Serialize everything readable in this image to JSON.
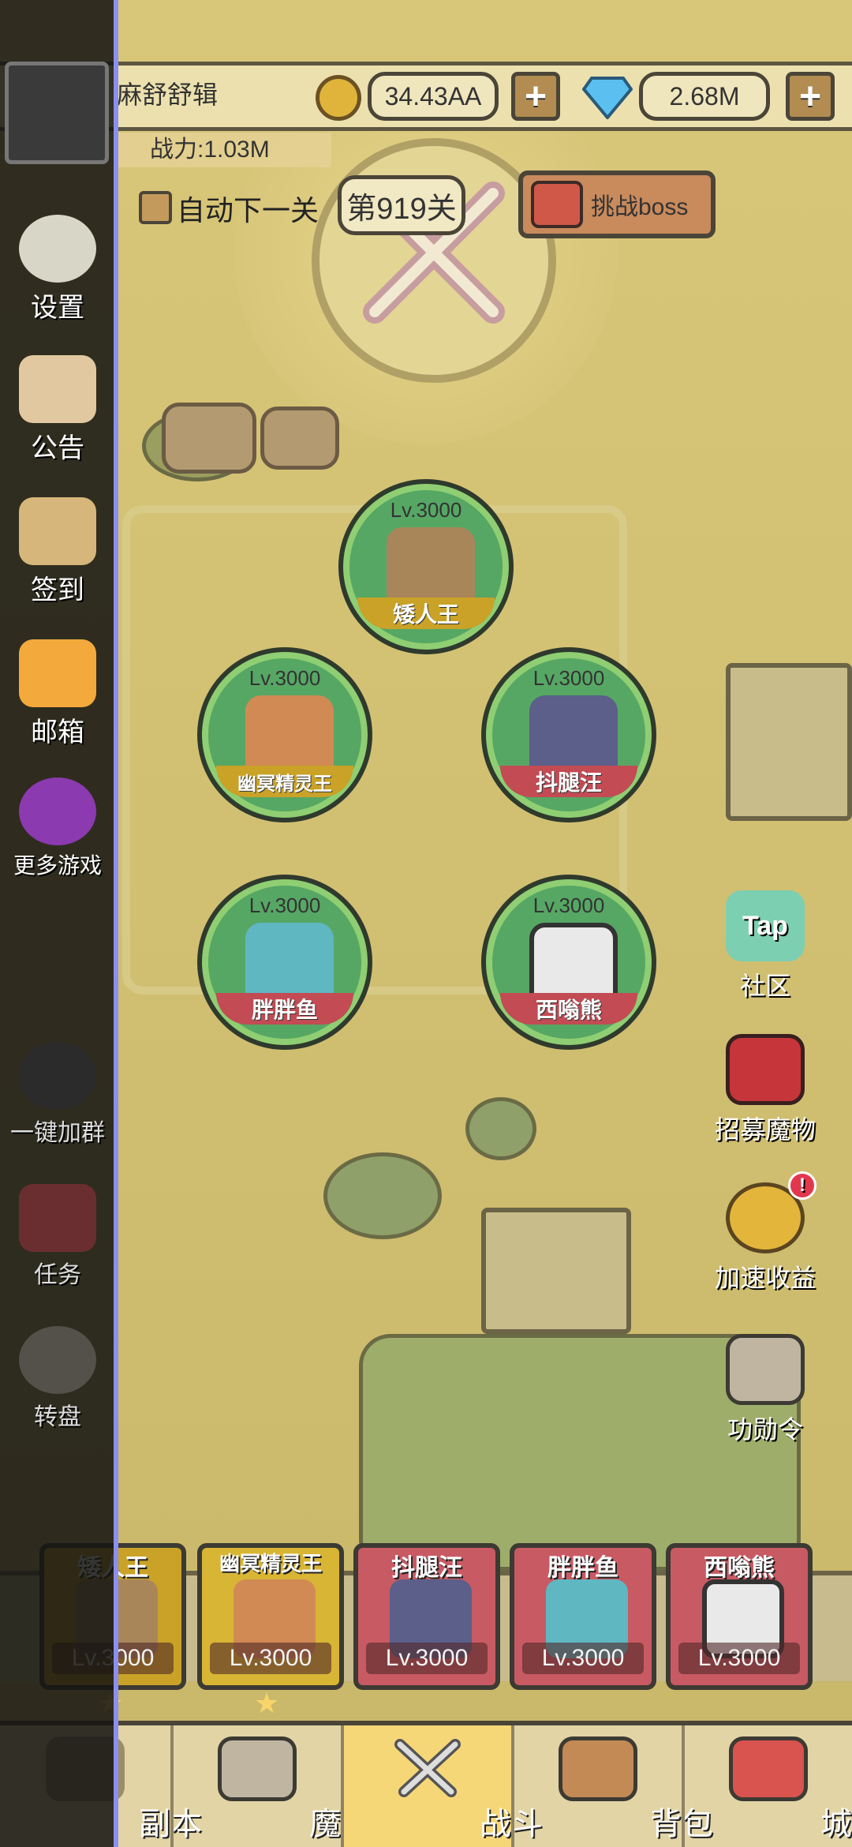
{
  "top": {
    "player_name": "麻舒舒辑",
    "gold": "34.43AA",
    "gems": "2.68M",
    "plus": "+",
    "power": "战力:1.03M"
  },
  "stage": {
    "auto_next_label": "自动下一关",
    "level_label": "第919关",
    "boss_button": "挑战boss"
  },
  "left_menu": [
    {
      "label": "设置",
      "icon": "gear-icon"
    },
    {
      "label": "公告",
      "icon": "notice-icon"
    },
    {
      "label": "签到",
      "icon": "scroll-icon"
    },
    {
      "label": "邮箱",
      "icon": "mail-icon"
    },
    {
      "label": "更多游戏",
      "icon": "more-games-icon"
    },
    {
      "label": "一键加群",
      "icon": "qq-icon"
    },
    {
      "label": "任务",
      "icon": "quest-book-icon"
    },
    {
      "label": "转盘",
      "icon": "wheel-icon"
    }
  ],
  "heroes": [
    {
      "level": "Lv.3000",
      "name": "矮人王",
      "band": "#c9a227"
    },
    {
      "level": "Lv.3000",
      "name": "幽冥精灵王",
      "band": "#c9a227"
    },
    {
      "level": "Lv.3000",
      "name": "抖腿汪",
      "band": "#c24b54"
    },
    {
      "level": "Lv.3000",
      "name": "胖胖鱼",
      "band": "#c24b54"
    },
    {
      "level": "Lv.3000",
      "name": "西嗡熊",
      "band": "#c24b54"
    }
  ],
  "right_menu": [
    {
      "label": "社区",
      "icon": "tap-cloud-icon",
      "badge": "Tap"
    },
    {
      "label": "招募魔物",
      "icon": "recruit-banner-icon"
    },
    {
      "label": "加速收益",
      "icon": "speed-gold-icon",
      "badge": "!"
    },
    {
      "label": "功勋令",
      "icon": "helmet-icon"
    }
  ],
  "team_cards": [
    {
      "name": "矮人王",
      "level": "Lv.3000",
      "color": "#c9a227"
    },
    {
      "name": "幽冥精灵王",
      "level": "Lv.3000",
      "color": "#d8b534"
    },
    {
      "name": "抖腿汪",
      "level": "Lv.3000",
      "color": "#c85a63"
    },
    {
      "name": "胖胖鱼",
      "level": "Lv.3000",
      "color": "#c85a63"
    },
    {
      "name": "西嗡熊",
      "level": "Lv.3000",
      "color": "#c85a63"
    }
  ],
  "bottom_nav": [
    {
      "label": "副本",
      "icon": "map-icon"
    },
    {
      "label": "魔物",
      "icon": "monster-helmet-icon"
    },
    {
      "label": "战斗",
      "icon": "swords-icon",
      "active": true
    },
    {
      "label": "背包",
      "icon": "backpack-icon"
    },
    {
      "label": "城镇",
      "icon": "town-icon"
    }
  ]
}
